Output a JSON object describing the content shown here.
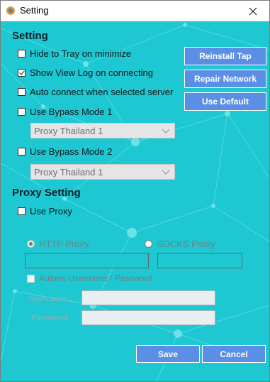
{
  "window": {
    "title": "Setting"
  },
  "setting": {
    "heading": "Setting",
    "options": [
      {
        "label": "Hide to Tray on minimize",
        "checked": false
      },
      {
        "label": "Show View Log on connecting",
        "checked": true
      },
      {
        "label": "Auto connect when selected server",
        "checked": false
      },
      {
        "label": "Use Bypass Mode 1",
        "checked": false
      },
      {
        "label": "Use Bypass Mode 2",
        "checked": false
      }
    ],
    "bypass_mode_1_select": "Proxy Thailand 1",
    "bypass_mode_2_select": "Proxy Thailand 1",
    "buttons": {
      "reinstall_tap": "Reinstall Tap",
      "repair_network": "Repair Network",
      "use_default": "Use Default"
    }
  },
  "proxy": {
    "heading": "Proxy Setting",
    "use_proxy_label": "Use Proxy",
    "use_proxy_checked": false,
    "http_proxy_label": "HTTP Proxy",
    "socks_proxy_label": "SOCKS Proxy",
    "http_proxy_value": "",
    "socks_proxy_value": "",
    "authen_label": "Authen Username / Password",
    "username_label": "Username :",
    "password_label": "Password :",
    "username_value": "",
    "password_value": ""
  },
  "footer": {
    "save": "Save",
    "cancel": "Cancel"
  },
  "colors": {
    "background": "#1ec8d2",
    "button": "#5b8fe6"
  },
  "icons": {
    "app": "app-logo-icon",
    "close": "close-icon",
    "dropdown": "chevron-down-icon"
  }
}
